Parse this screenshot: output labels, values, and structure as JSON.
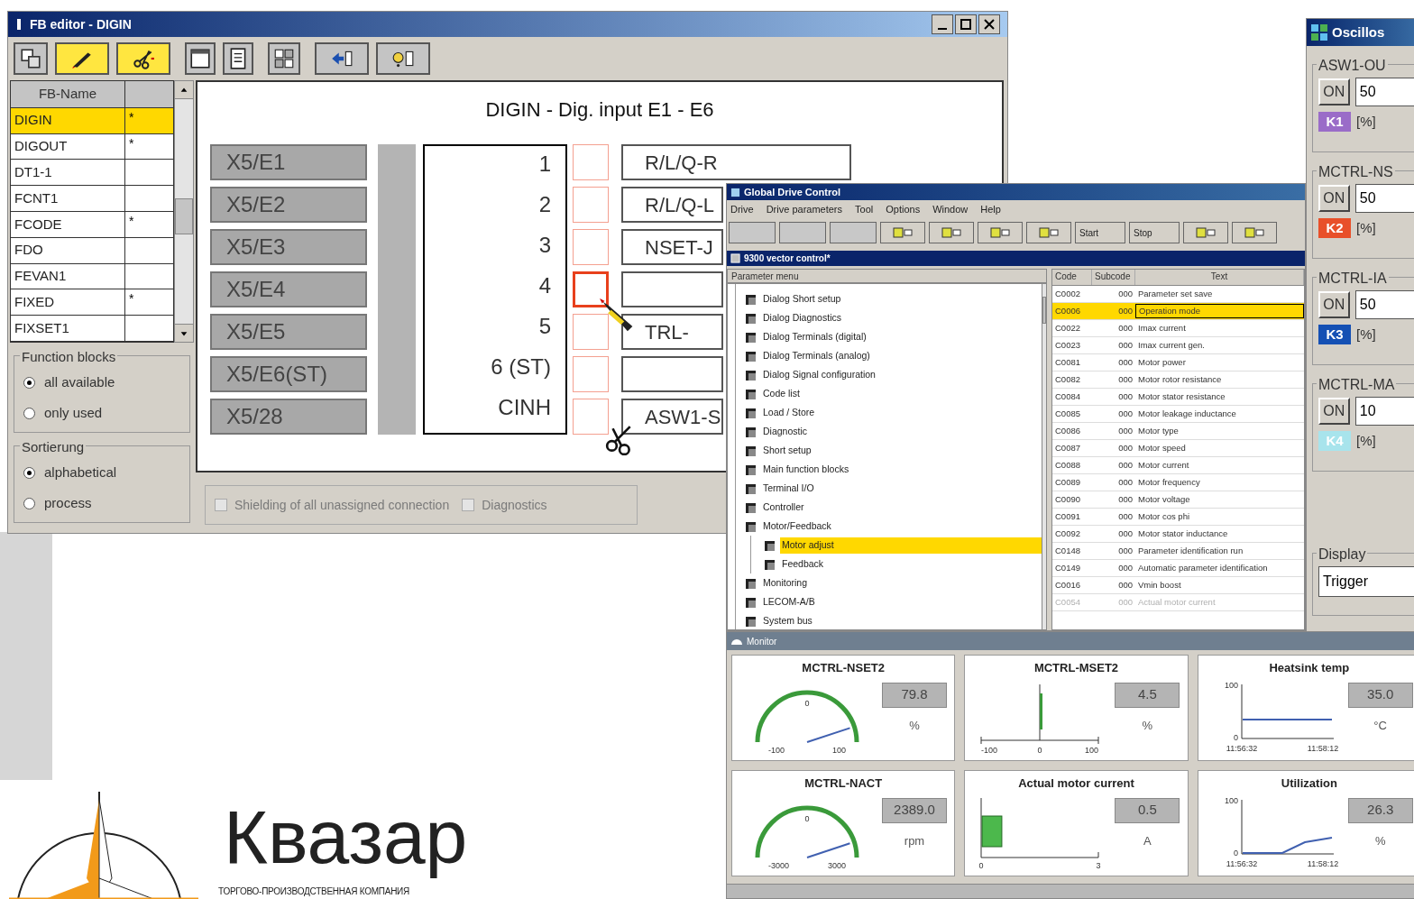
{
  "fb_editor": {
    "title": "FB editor - DIGIN",
    "toolbar": [
      {
        "kind": "blocks",
        "selected": false
      },
      {
        "kind": "pen",
        "selected": true
      },
      {
        "kind": "scissors",
        "selected": true
      },
      {
        "kind": "window",
        "selected": false
      },
      {
        "kind": "document",
        "selected": false
      },
      {
        "kind": "grid",
        "selected": false
      },
      {
        "kind": "arrow",
        "selected": false
      },
      {
        "kind": "help",
        "selected": false
      }
    ],
    "list": {
      "columns": [
        "FB-Name"
      ],
      "rows": [
        {
          "name": "DIGIN",
          "mark": "*",
          "selected": true
        },
        {
          "name": "DIGOUT",
          "mark": "*",
          "selected": false
        },
        {
          "name": "DT1-1",
          "selected": false
        },
        {
          "name": "FCNT1",
          "selected": false
        },
        {
          "name": "FCODE",
          "mark": "*",
          "selected": false
        },
        {
          "name": "FDO",
          "selected": false
        },
        {
          "name": "FEVAN1",
          "selected": false
        },
        {
          "name": "FIXED",
          "mark": "*",
          "selected": false
        },
        {
          "name": "FIXSET1",
          "selected": false
        }
      ]
    },
    "function_blocks": {
      "title": "Function blocks",
      "options": [
        {
          "label": "all available",
          "selected": true
        },
        {
          "label": "only used",
          "selected": false
        }
      ]
    },
    "sorting": {
      "title": "Sortierung",
      "options": [
        {
          "label": "alphabetical",
          "selected": true
        },
        {
          "label": "process",
          "selected": false
        }
      ]
    },
    "diagram": {
      "title": "DIGIN - Dig. input E1 - E6",
      "rows": [
        {
          "input": "X5/E1",
          "pin": "1",
          "output": "R/L/Q-R",
          "selected": false
        },
        {
          "input": "X5/E2",
          "pin": "2",
          "output": "R/L/Q-L",
          "selected": false
        },
        {
          "input": "X5/E3",
          "pin": "3",
          "output": "NSET-J",
          "selected": false
        },
        {
          "input": "X5/E4",
          "pin": "4",
          "selected": true
        },
        {
          "input": "X5/E5",
          "pin": "5",
          "output": "TRL-",
          "selected": false
        },
        {
          "input": "X5/E6(ST)",
          "pin": "6 (ST)",
          "selected": false
        },
        {
          "input": "X5/28",
          "pin": "CINH",
          "output": "ASW1-S",
          "selected": false
        }
      ]
    },
    "options": [
      {
        "label": "Shielding of all unassigned connection",
        "checked": false,
        "disabled": true
      },
      {
        "label": "Diagnostics",
        "checked": false,
        "disabled": true
      }
    ]
  },
  "gdc": {
    "title": "Global Drive Control",
    "menu": [
      "Drive",
      "Drive parameters",
      "Tool",
      "Options",
      "Window",
      "Help"
    ],
    "toolbar": [
      {
        "kind": "blank"
      },
      {
        "kind": "blank"
      },
      {
        "kind": "blank"
      },
      {
        "kind": "icon"
      },
      {
        "kind": "icon"
      },
      {
        "kind": "icon"
      },
      {
        "kind": "icon"
      },
      {
        "kind": "text",
        "label": "Start"
      },
      {
        "kind": "text",
        "label": "Stop"
      },
      {
        "kind": "icon"
      },
      {
        "kind": "icon"
      }
    ],
    "document": {
      "title": "9300 vector control*",
      "tree": {
        "header": "Parameter menu",
        "items": [
          {
            "label": "Dialog Short setup",
            "selected": false
          },
          {
            "label": "Dialog Diagnostics",
            "selected": false
          },
          {
            "label": "Dialog Terminals (digital)",
            "selected": false
          },
          {
            "label": "Dialog Terminals (analog)",
            "selected": false
          },
          {
            "label": "Dialog Signal configuration",
            "selected": false
          },
          {
            "label": "Code list",
            "selected": false
          },
          {
            "label": "Load / Store",
            "selected": false
          },
          {
            "label": "Diagnostic",
            "selected": false
          },
          {
            "label": "Short setup",
            "selected": false
          },
          {
            "label": "Main function blocks",
            "selected": false
          },
          {
            "label": "Terminal I/O",
            "selected": false
          },
          {
            "label": "Controller",
            "selected": false
          },
          {
            "label": "Motor/Feedback",
            "selected": false,
            "children": [
              {
                "label": "Motor adjust",
                "selected": true
              },
              {
                "label": "Feedback",
                "selected": false
              }
            ]
          },
          {
            "label": "Monitoring",
            "selected": false
          },
          {
            "label": "LECOM-A/B",
            "selected": false
          },
          {
            "label": "System bus",
            "selected": false
          }
        ]
      },
      "table": {
        "columns": [
          "Code",
          "Subcode",
          "Text"
        ],
        "rows": [
          {
            "code": "C0002",
            "subcode": "000",
            "text": "Parameter set save",
            "selected": false,
            "disabled": false
          },
          {
            "code": "C0006",
            "subcode": "000",
            "text": "Operation mode",
            "selected": true,
            "disabled": false
          },
          {
            "code": "C0022",
            "subcode": "000",
            "text": "Imax current",
            "selected": false,
            "disabled": false
          },
          {
            "code": "C0023",
            "subcode": "000",
            "text": "Imax current gen.",
            "selected": false,
            "disabled": false
          },
          {
            "code": "C0081",
            "subcode": "000",
            "text": "Motor power",
            "selected": false,
            "disabled": false
          },
          {
            "code": "C0082",
            "subcode": "000",
            "text": "Motor rotor resistance",
            "selected": false,
            "disabled": false
          },
          {
            "code": "C0084",
            "subcode": "000",
            "text": "Motor stator resistance",
            "selected": false,
            "disabled": false
          },
          {
            "code": "C0085",
            "subcode": "000",
            "text": "Motor leakage inductance",
            "selected": false,
            "disabled": false
          },
          {
            "code": "C0086",
            "subcode": "000",
            "text": "Motor type",
            "selected": false,
            "disabled": false
          },
          {
            "code": "C0087",
            "subcode": "000",
            "text": "Motor speed",
            "selected": false,
            "disabled": false
          },
          {
            "code": "C0088",
            "subcode": "000",
            "text": "Motor current",
            "selected": false,
            "disabled": false
          },
          {
            "code": "C0089",
            "subcode": "000",
            "text": "Motor frequency",
            "selected": false,
            "disabled": false
          },
          {
            "code": "C0090",
            "subcode": "000",
            "text": "Motor voltage",
            "selected": false,
            "disabled": false
          },
          {
            "code": "C0091",
            "subcode": "000",
            "text": "Motor cos phi",
            "selected": false,
            "disabled": false
          },
          {
            "code": "C0092",
            "subcode": "000",
            "text": "Motor stator inductance",
            "selected": false,
            "disabled": false
          },
          {
            "code": "C0148",
            "subcode": "000",
            "text": "Parameter identification run",
            "selected": false,
            "disabled": false
          },
          {
            "code": "C0149",
            "subcode": "000",
            "text": "Automatic parameter identification",
            "selected": false,
            "disabled": false
          },
          {
            "code": "C0016",
            "subcode": "000",
            "text": "Vmin boost",
            "selected": false,
            "disabled": false
          },
          {
            "code": "C0054",
            "subcode": "000",
            "text": "Actual motor current",
            "selected": false,
            "disabled": true
          }
        ]
      }
    }
  },
  "monitor": {
    "title": "Monitor",
    "cards": [
      {
        "title": "MCTRL-NSET2",
        "kind": "gauge",
        "ticks": [
          "-100",
          "0",
          "100"
        ],
        "value": "79.8",
        "unit": "%"
      },
      {
        "title": "MCTRL-MSET2",
        "kind": "center_bar",
        "level": 0.52,
        "ticks": [
          "-100",
          "0",
          "100"
        ],
        "value": "4.5",
        "unit": "%"
      },
      {
        "title": "Heatsink temp",
        "kind": "trend_flat",
        "ticks": [
          "100",
          "0",
          "11:56:32",
          "11:58:12"
        ],
        "value": "35.0",
        "unit": "°C"
      },
      {
        "title": "MCTRL-NACT",
        "kind": "gauge",
        "ticks": [
          "-3000",
          "0",
          "3000"
        ],
        "value": "2389.0",
        "unit": "rpm"
      },
      {
        "title": "Actual motor current",
        "kind": "bar",
        "level": 0.17,
        "ticks": [
          "0",
          "3"
        ],
        "value": "0.5",
        "unit": "A"
      },
      {
        "title": "Utilization",
        "kind": "trend_rising",
        "ticks": [
          "100",
          "0",
          "11:56:32",
          "11:58:12"
        ],
        "value": "26.3",
        "unit": "%"
      }
    ]
  },
  "oscilloscope": {
    "title": "Oscillos",
    "channels": [
      {
        "name": "ASW1-OU",
        "button": "ON",
        "value": "50",
        "tag": "K1",
        "color": "#9a6cc8",
        "unit": "[%]"
      },
      {
        "name": "MCTRL-NS",
        "button": "ON",
        "value": "50",
        "tag": "K2",
        "color": "#e8502a",
        "unit": "[%]"
      },
      {
        "name": "MCTRL-IA",
        "button": "ON",
        "value": "50",
        "tag": "K3",
        "color": "#1450b4",
        "unit": "[%]"
      },
      {
        "name": "MCTRL-MA",
        "button": "ON",
        "value": "10",
        "tag": "K4",
        "color": "#a8e4ec",
        "unit": "[%]"
      }
    ],
    "display": {
      "title": "Display",
      "value": "Trigger"
    }
  },
  "logo": {
    "name": "Квазар",
    "tagline": "ТОРГОВО-ПРОИЗВОДСТВЕННАЯ КОМПАНИЯ"
  }
}
